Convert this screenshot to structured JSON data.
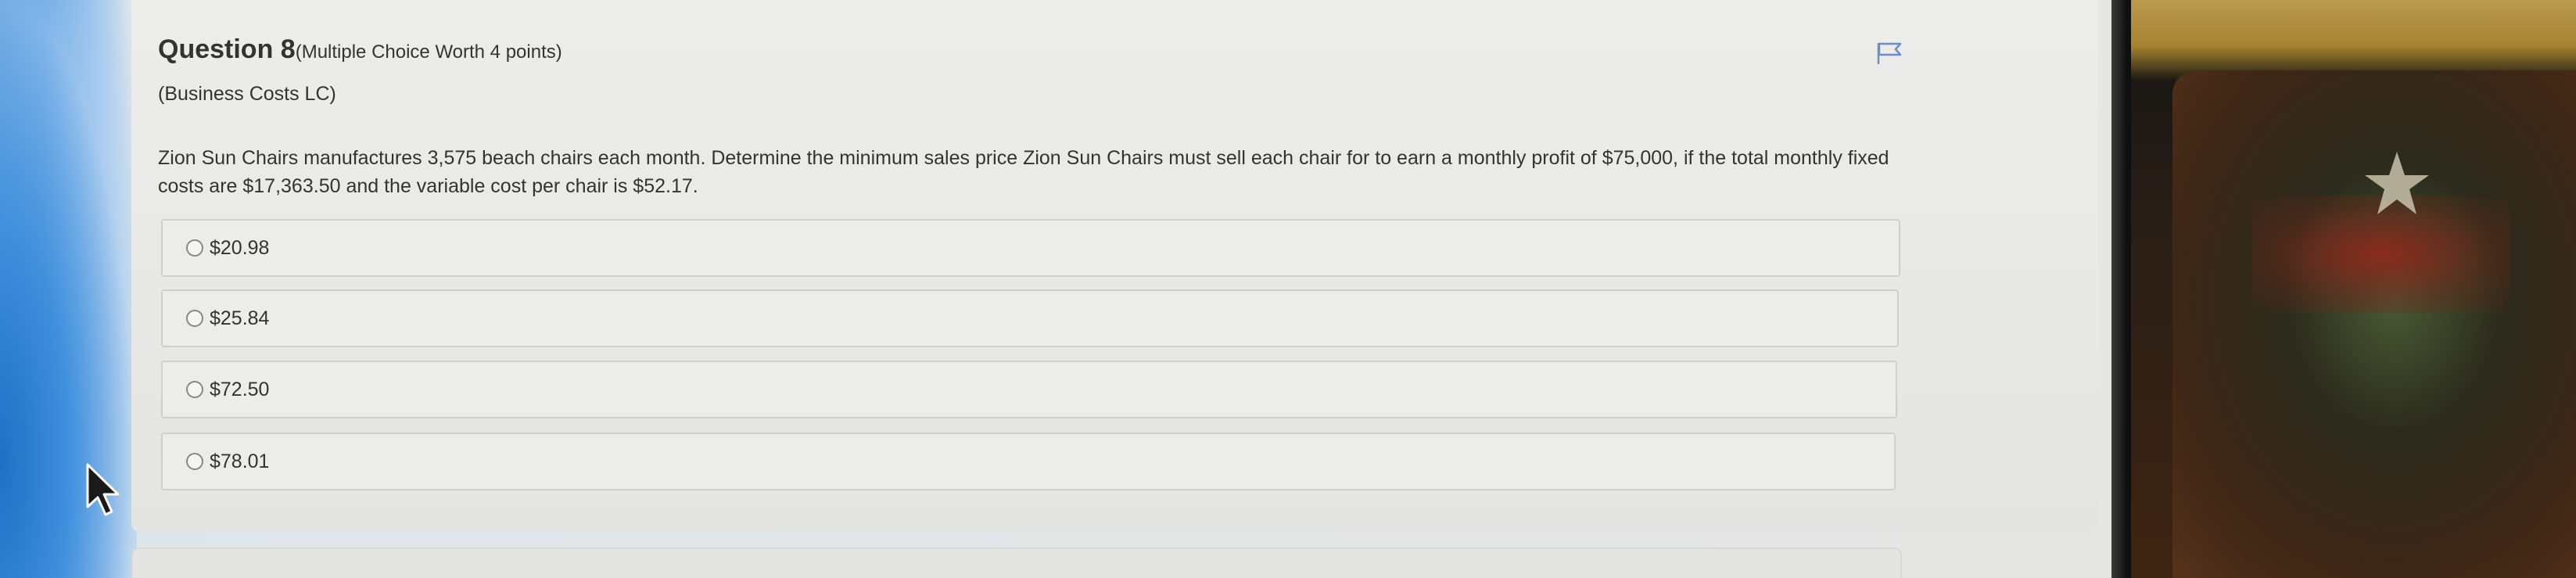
{
  "question": {
    "number_label": "Question 8",
    "worth_label": "(Multiple Choice Worth 4 points)",
    "category": "(Business Costs LC)",
    "text": "Zion Sun Chairs manufactures 3,575 beach chairs each month. Determine the minimum sales price Zion Sun Chairs must sell each chair for to earn a monthly profit of $75,000, if the total monthly fixed costs are $17,363.50 and the variable cost per chair is $52.17."
  },
  "options": [
    {
      "label": "$20.98",
      "selected": false
    },
    {
      "label": "$25.84",
      "selected": false
    },
    {
      "label": "$72.50",
      "selected": false
    },
    {
      "label": "$78.01",
      "selected": false
    }
  ],
  "icons": {
    "flag": "flag-icon",
    "cursor": "mouse-pointer-icon"
  },
  "colors": {
    "card_background": "#ececea",
    "text": "#333333",
    "option_border": "#cfcfcd",
    "desktop_blue": "#2d7fd0"
  }
}
